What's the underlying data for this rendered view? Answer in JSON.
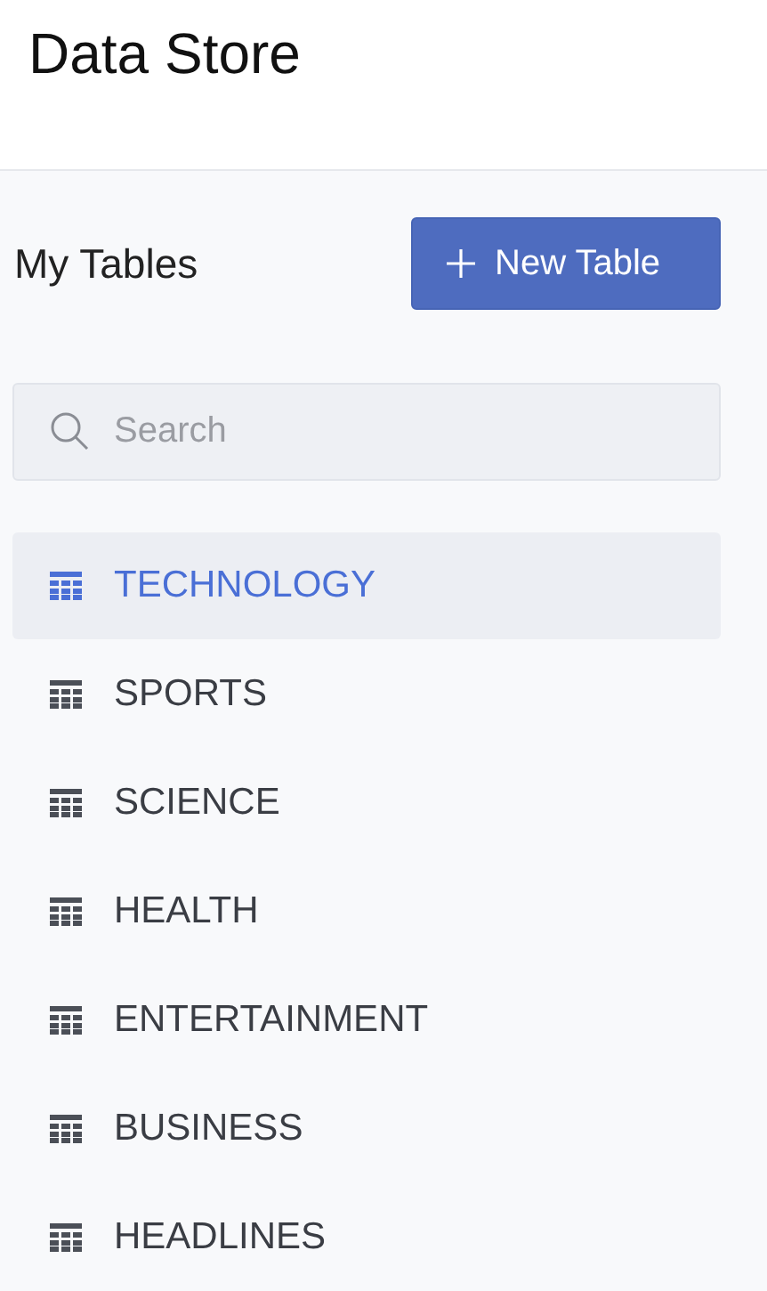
{
  "header": {
    "title": "Data Store"
  },
  "panel": {
    "heading": "My Tables",
    "new_button": "New Table",
    "search": {
      "placeholder": "Search"
    },
    "tables": [
      {
        "name": "TECHNOLOGY",
        "selected": true
      },
      {
        "name": "SPORTS",
        "selected": false
      },
      {
        "name": "SCIENCE",
        "selected": false
      },
      {
        "name": "HEALTH",
        "selected": false
      },
      {
        "name": "ENTERTAINMENT",
        "selected": false
      },
      {
        "name": "BUSINESS",
        "selected": false
      },
      {
        "name": "HEADLINES",
        "selected": false
      }
    ]
  }
}
